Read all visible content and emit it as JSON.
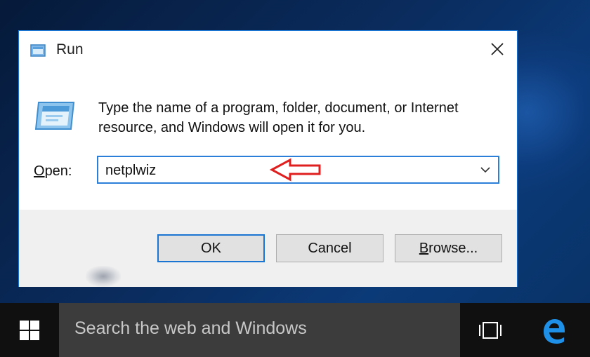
{
  "dialog": {
    "title": "Run",
    "description": "Type the name of a program, folder, document, or Internet resource, and Windows will open it for you.",
    "open_label_underlined": "O",
    "open_label_rest": "pen:",
    "open_value": "netplwiz",
    "buttons": {
      "ok": "OK",
      "cancel": "Cancel",
      "browse_underlined": "B",
      "browse_rest": "rowse..."
    }
  },
  "taskbar": {
    "search_placeholder": "Search the web and Windows"
  },
  "icons": {
    "title": "run-icon",
    "dialog": "run-large-icon",
    "close": "close-icon",
    "dropdown": "chevron-down-icon",
    "annotation": "red-arrow-left-icon",
    "start": "windows-logo-icon",
    "task_view": "task-view-icon",
    "browser": "edge-icon"
  },
  "colors": {
    "accent": "#1a74d1",
    "arrow": "#e01f1f",
    "taskbar": "#101010",
    "search_box": "#3c3c3c",
    "edge": "#1e90e8"
  }
}
